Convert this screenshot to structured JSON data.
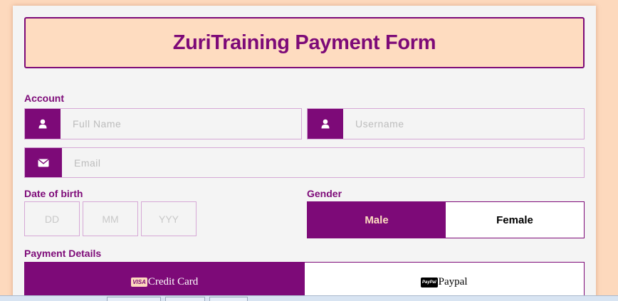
{
  "form": {
    "title": "ZuriTraining Payment Form"
  },
  "account": {
    "label": "Account",
    "full_name": {
      "placeholder": "Full Name",
      "icon": "user-icon"
    },
    "username": {
      "placeholder": "Username",
      "icon": "user-icon"
    },
    "email": {
      "placeholder": "Email",
      "icon": "envelope-icon"
    }
  },
  "dob": {
    "label": "Date of birth",
    "day_placeholder": "DD",
    "month_placeholder": "MM",
    "year_placeholder": "YYY"
  },
  "gender": {
    "label": "Gender",
    "options": [
      "Male",
      "Female"
    ],
    "selected": "Male"
  },
  "payment": {
    "label": "Payment Details",
    "options": [
      {
        "badge": "VISA",
        "label": "Credit Card"
      },
      {
        "badge": "PayPal",
        "label": "Paypal"
      }
    ],
    "selected": "Credit Card"
  },
  "colors": {
    "accent": "#7d0a78",
    "header_bg": "#fedcc0",
    "page_bg": "#fdd9bd",
    "card_bg": "#f4f4f4"
  }
}
